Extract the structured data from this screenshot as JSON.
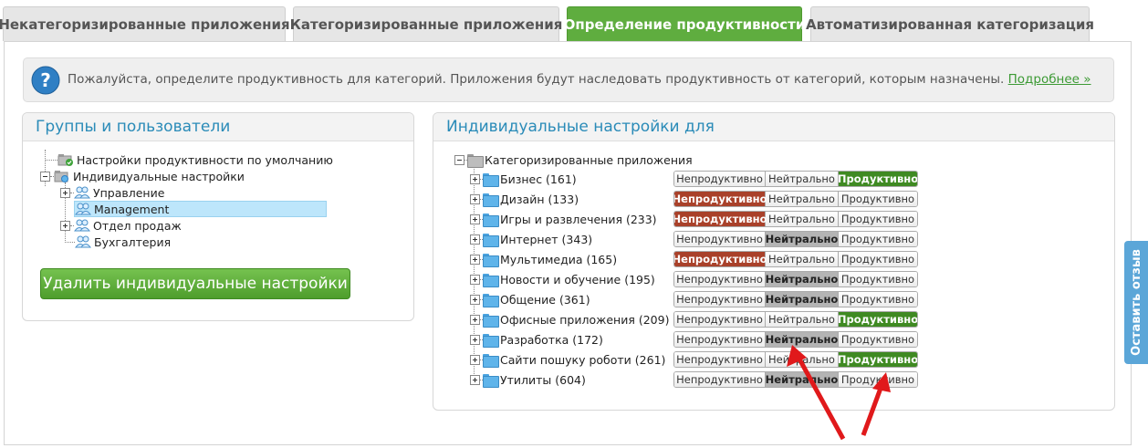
{
  "tabs": [
    {
      "label": "Некатегоризированные приложения",
      "active": false
    },
    {
      "label": "Категоризированные приложения",
      "active": false
    },
    {
      "label": "Определение продуктивности",
      "active": true
    },
    {
      "label": "Автоматизированная категоризация",
      "active": false
    }
  ],
  "info": {
    "text": "Пожалуйста, определите продуктивность для категорий. Приложения будут наследовать продуктивность от категорий, которым назначены.",
    "link": "Подробнее »",
    "icon": "question-icon"
  },
  "left_panel": {
    "title": "Группы и пользователи",
    "tree": [
      {
        "label": "Настройки продуктивности по умолчанию",
        "icon": "default-settings-icon"
      },
      {
        "label": "Индивидуальные настройки",
        "icon": "individual-settings-icon"
      },
      {
        "label": "Управление",
        "icon": "users-icon"
      },
      {
        "label": "Management",
        "icon": "users-icon",
        "selected": true
      },
      {
        "label": "Отдел продаж",
        "icon": "users-icon"
      },
      {
        "label": "Бухгалтерия",
        "icon": "users-icon"
      }
    ],
    "delete_button": "Удалить индивидуальные настройки"
  },
  "right_panel": {
    "title": "Индивидуальные настройки для",
    "root": "Категоризированные приложения",
    "options": [
      "Непродуктивно",
      "Нейтрально",
      "Продуктивно"
    ],
    "categories": [
      {
        "label": "Бизнес (161)",
        "state": "productive"
      },
      {
        "label": "Дизайн (133)",
        "state": "unproductive"
      },
      {
        "label": "Игры и развлечения (233)",
        "state": "unproductive"
      },
      {
        "label": "Интернет (343)",
        "state": "neutral"
      },
      {
        "label": "Мультимедиа (165)",
        "state": "unproductive"
      },
      {
        "label": "Новости и обучение (195)",
        "state": "neutral"
      },
      {
        "label": "Общение (361)",
        "state": "neutral"
      },
      {
        "label": "Офисные приложения (209)",
        "state": "productive"
      },
      {
        "label": "Разработка (172)",
        "state": "neutral"
      },
      {
        "label": "Сайти пошуку роботи (261)",
        "state": "productive"
      },
      {
        "label": "Утилиты (604)",
        "state": "neutral"
      }
    ]
  },
  "feedback": {
    "label": "Оставить отзыв"
  },
  "colors": {
    "accent_green": "#5fad3f",
    "unproductive": "#a9412a",
    "productive": "#3f8a22",
    "title_blue": "#2a8bb8",
    "annotation_red": "#e0191b"
  }
}
